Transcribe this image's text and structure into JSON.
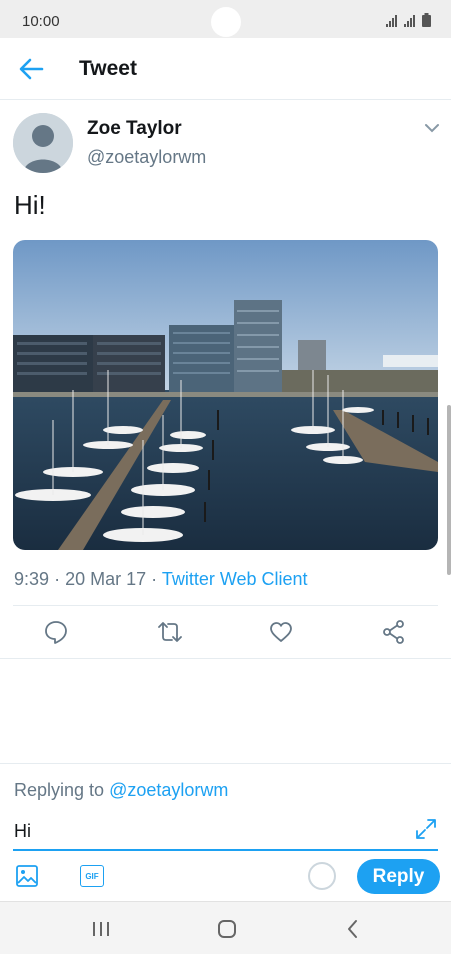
{
  "status_bar": {
    "time": "10:00"
  },
  "header": {
    "title": "Tweet"
  },
  "tweet": {
    "author_name": "Zoe Taylor",
    "author_handle": "@zoetaylorwm",
    "text": "Hi!",
    "time": "9:39",
    "date": "20 Mar 17",
    "separator": "·",
    "client": "Twitter Web Client"
  },
  "reply": {
    "replying_prefix": "Replying to",
    "replying_handle": "@zoetaylorwm",
    "input_value": "Hi",
    "button_label": "Reply",
    "gif_label": "GIF"
  },
  "icons": {
    "back": "arrow-left-icon",
    "reply": "comment-icon",
    "retweet": "retweet-icon",
    "like": "heart-icon",
    "share": "share-icon",
    "media": "image-icon",
    "gif": "gif-icon",
    "expand": "expand-icon"
  },
  "colors": {
    "accent": "#1da1f2",
    "secondary_text": "#657786"
  }
}
